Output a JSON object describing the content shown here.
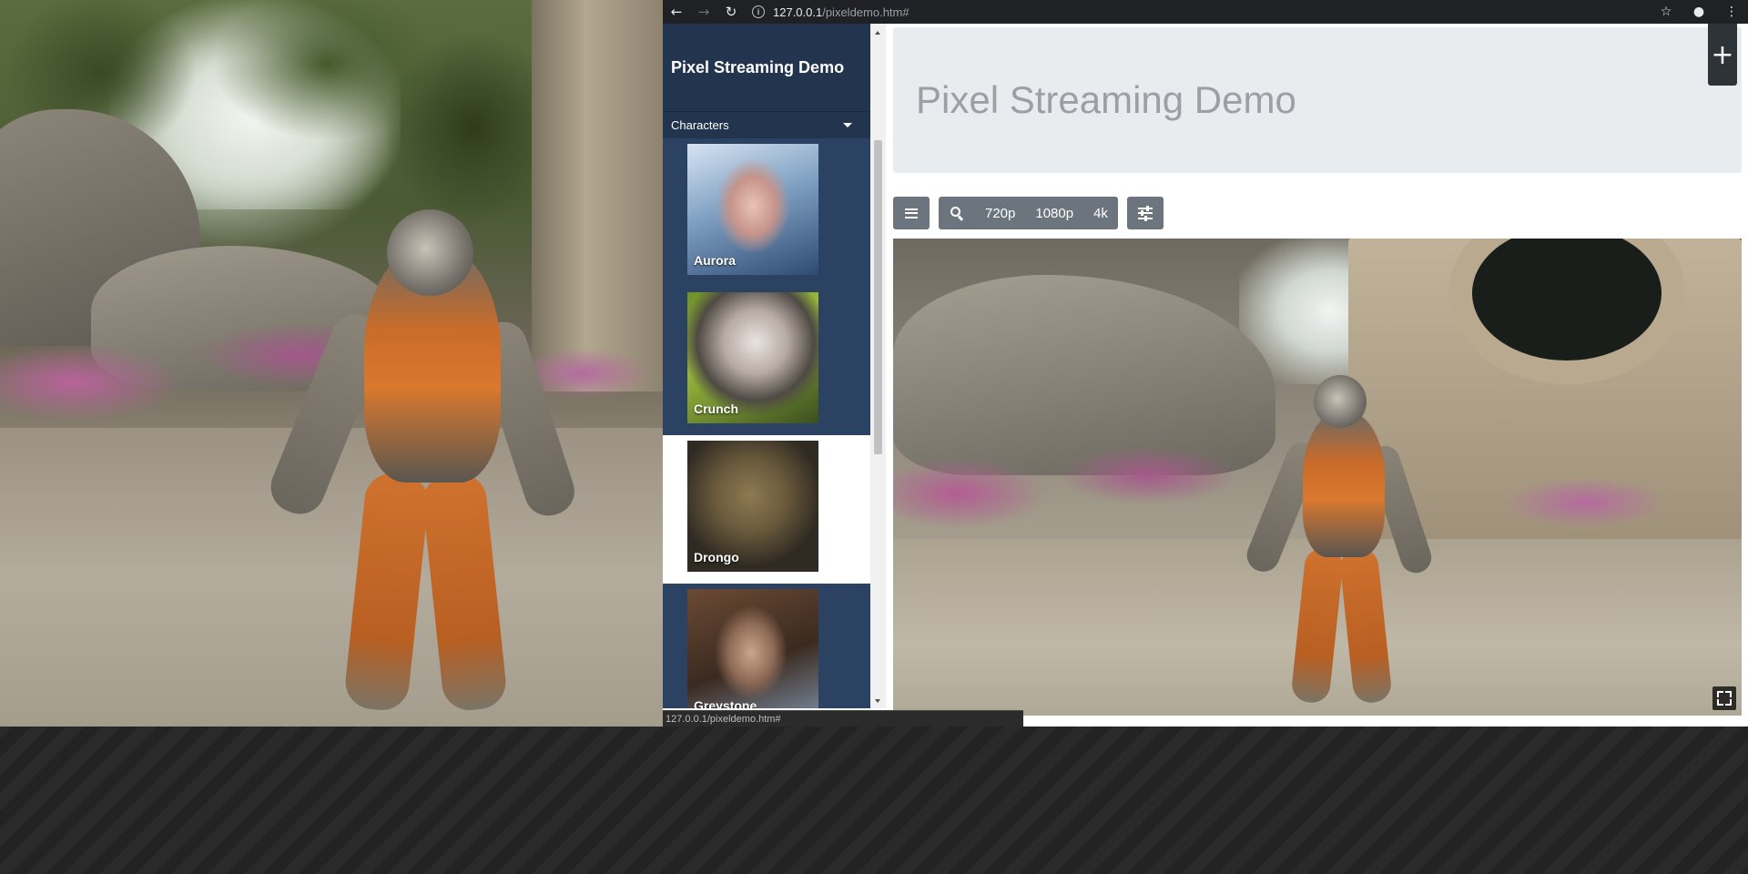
{
  "browser": {
    "url_host": "127.0.0.1",
    "url_path": "/pixeldemo.htm#",
    "status_url": "127.0.0.1/pixeldemo.htm#"
  },
  "sidebar": {
    "title": "Pixel Streaming Demo",
    "dropdown_label": "Characters",
    "characters": [
      {
        "name": "Aurora",
        "active": false
      },
      {
        "name": "Crunch",
        "active": false
      },
      {
        "name": "Drongo",
        "active": true
      },
      {
        "name": "Greystone",
        "active": false
      }
    ]
  },
  "main": {
    "title": "Pixel Streaming Demo",
    "plus_label": "+",
    "resolutions": [
      "720p",
      "1080p",
      "4k"
    ]
  },
  "colors": {
    "sidebar": "#2b4263",
    "sidebar_header": "#22344e",
    "button": "#6c757d",
    "jumbotron": "#e9ecef"
  },
  "icons": [
    "back-arrow-icon",
    "forward-arrow-icon",
    "reload-icon",
    "info-icon",
    "star-icon",
    "incognito-icon",
    "menu-dots-icon",
    "hamburger-icon",
    "zoom-icon",
    "sliders-icon",
    "fullscreen-icon"
  ]
}
